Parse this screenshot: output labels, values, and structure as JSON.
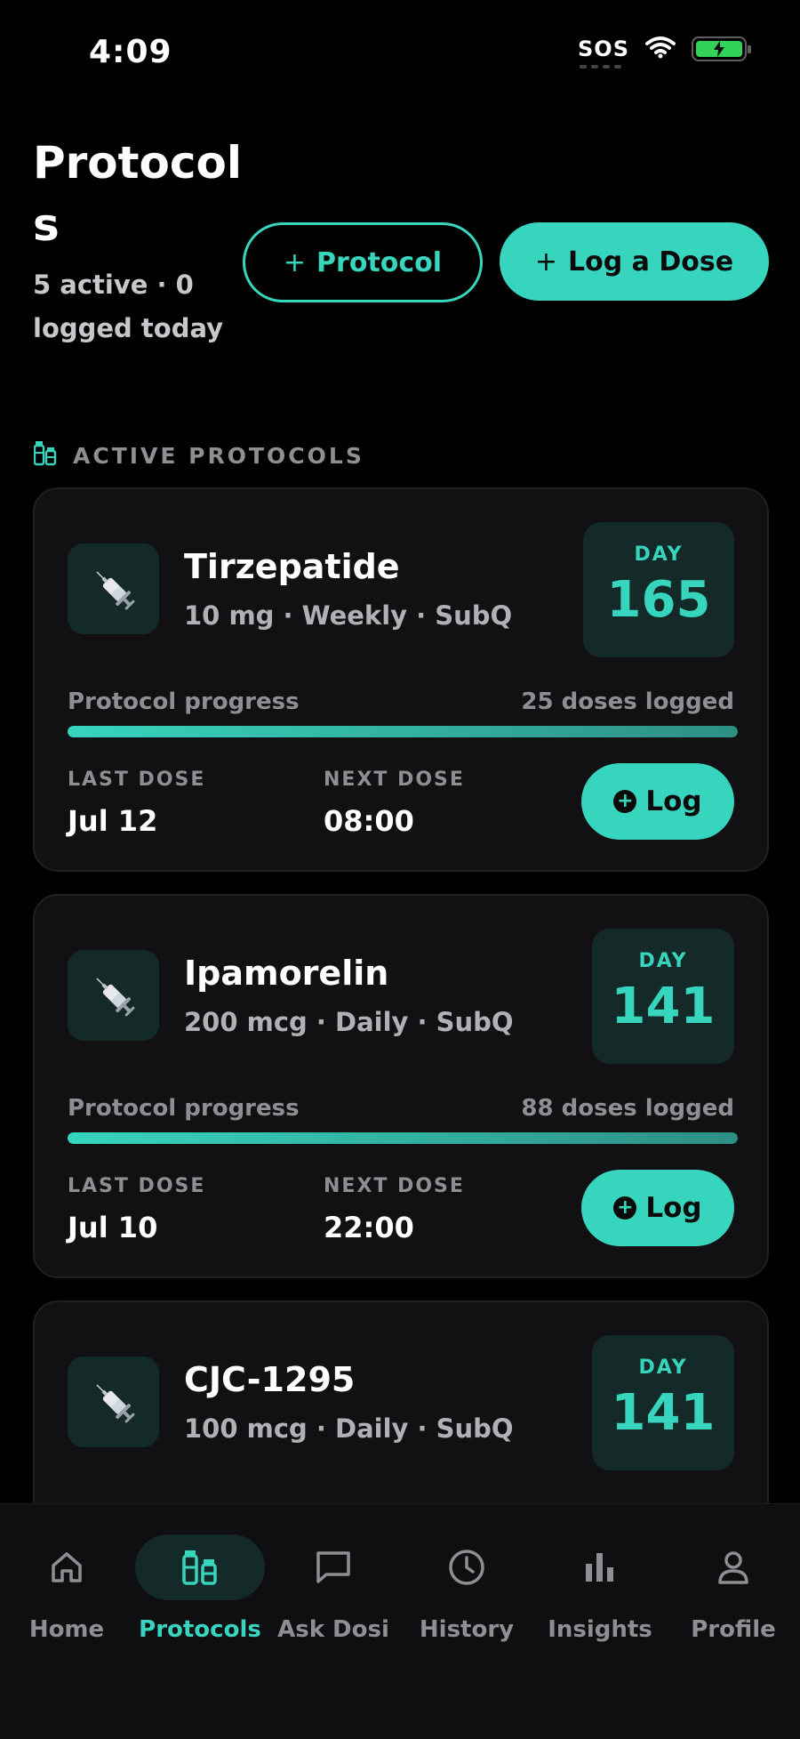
{
  "status_bar": {
    "time": "4:09",
    "sos": "SOS",
    "battery_color": "#33d35a"
  },
  "header": {
    "title": "Protocols",
    "subtitle": "5 active · 0 logged today",
    "add_protocol_label": "Protocol",
    "log_dose_label": "Log a Dose"
  },
  "section": {
    "label": "ACTIVE PROTOCOLS",
    "icon": "vials-icon"
  },
  "protocols": [
    {
      "name": "Tirzepatide",
      "detail": "10 mg · Weekly · SubQ",
      "day_label": "DAY",
      "day": "165",
      "progress_label": "Protocol progress",
      "doses_logged": "25 doses logged",
      "progress": 1.0,
      "last_dose_label": "LAST DOSE",
      "last_dose": "Jul 12",
      "next_dose_label": "NEXT DOSE",
      "next_dose": "08:00",
      "log_label": "Log"
    },
    {
      "name": "Ipamorelin",
      "detail": "200 mcg · Daily · SubQ",
      "day_label": "DAY",
      "day": "141",
      "progress_label": "Protocol progress",
      "doses_logged": "88 doses logged",
      "progress": 1.0,
      "last_dose_label": "LAST DOSE",
      "last_dose": "Jul 10",
      "next_dose_label": "NEXT DOSE",
      "next_dose": "22:00",
      "log_label": "Log"
    },
    {
      "name": "CJC-1295",
      "detail": "100 mcg · Daily · SubQ",
      "day_label": "DAY",
      "day": "141"
    }
  ],
  "nav": {
    "items": [
      {
        "label": "Home",
        "icon": "home-icon"
      },
      {
        "label": "Protocols",
        "icon": "vials-icon",
        "active": true
      },
      {
        "label": "Ask Dosi",
        "icon": "chat-icon"
      },
      {
        "label": "History",
        "icon": "clock-icon"
      },
      {
        "label": "Insights",
        "icon": "bar-chart-icon"
      },
      {
        "label": "Profile",
        "icon": "person-icon"
      }
    ]
  },
  "colors": {
    "accent": "#37d5be",
    "background": "#000000",
    "card": "#111114"
  }
}
